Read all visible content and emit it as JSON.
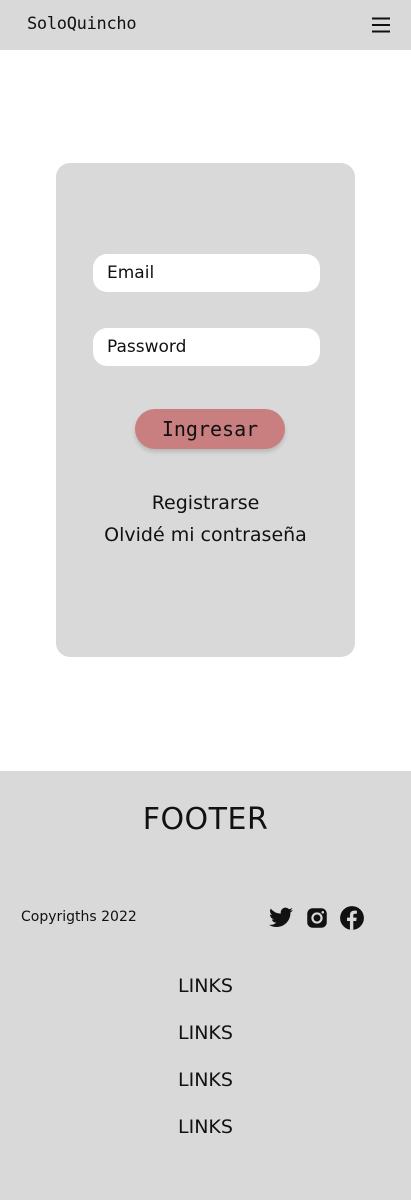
{
  "header": {
    "brand": "SoloQuincho",
    "menu_icon": "hamburger-menu-icon"
  },
  "login": {
    "email_placeholder": "Email",
    "password_placeholder": "Password",
    "submit_label": "Ingresar",
    "register_label": "Registrarse",
    "forgot_label": "Olvidé mi contraseña"
  },
  "footer": {
    "title": "FOOTER",
    "copyright": "Copyrigths 2022",
    "social": [
      "twitter-icon",
      "instagram-icon",
      "facebook-icon"
    ],
    "links": [
      "LINKS",
      "LINKS",
      "LINKS",
      "LINKS"
    ]
  },
  "colors": {
    "panel_gray": "#d9d9d9",
    "button_accent": "#c97f80",
    "text": "#111111",
    "background": "#ffffff"
  }
}
